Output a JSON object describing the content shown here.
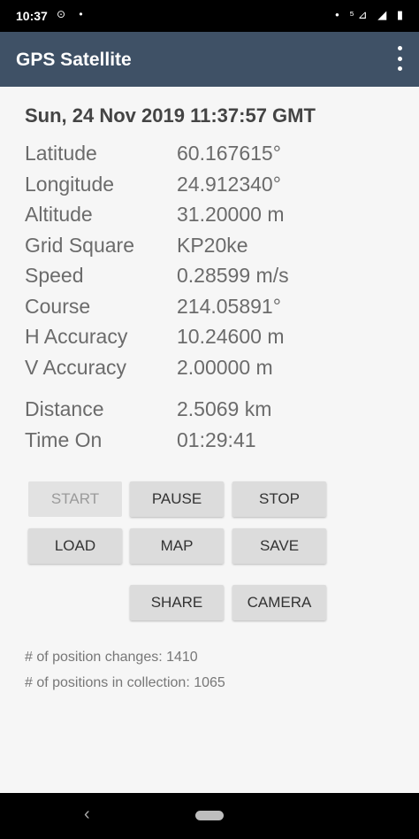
{
  "status_bar": {
    "time": "10:37",
    "left_icons": "⊙ •",
    "right_icons": "• ⁵⊿ ◢ ▮"
  },
  "app_bar": {
    "title": "GPS Satellite",
    "overflow_menu_icon": "more-vertical-icon"
  },
  "datetime": "Sun, 24 Nov 2019 11:37:57 GMT",
  "fields": [
    {
      "label": "Latitude",
      "value": "60.167615°"
    },
    {
      "label": "Longitude",
      "value": "24.912340°"
    },
    {
      "label": "Altitude",
      "value": "31.20000 m"
    },
    {
      "label": "Grid Square",
      "value": "KP20ke"
    },
    {
      "label": "Speed",
      "value": "0.28599 m/s"
    },
    {
      "label": "Course",
      "value": "214.05891°"
    },
    {
      "label": "H Accuracy",
      "value": "10.24600 m"
    },
    {
      "label": "V Accuracy",
      "value": "2.00000 m"
    }
  ],
  "fields2": [
    {
      "label": "Distance",
      "value": "2.5069 km"
    },
    {
      "label": "Time On",
      "value": "01:29:41"
    }
  ],
  "buttons": {
    "start": "START",
    "pause": "PAUSE",
    "stop": "STOP",
    "load": "LOAD",
    "map": "MAP",
    "save": "SAVE",
    "share": "SHARE",
    "camera": "CAMERA"
  },
  "stats": {
    "position_changes": "# of position changes:  1410",
    "positions_in_collection": "# of positions in collection:  1065"
  },
  "nav_bar": {
    "back_icon": "‹"
  },
  "colors": {
    "app_bar": "#3f5166",
    "background": "#f6f6f6",
    "button": "#dcdcdc"
  }
}
